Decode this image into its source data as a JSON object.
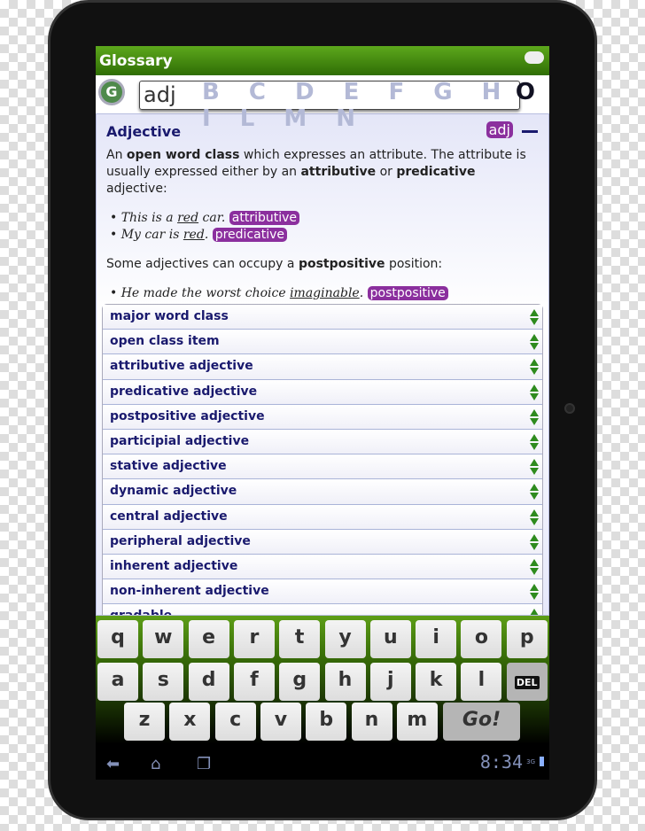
{
  "app": {
    "title": "Glossary"
  },
  "alphabet": {
    "letters": "B C D E F G H I L M N",
    "last": "O"
  },
  "search": {
    "value": "adj",
    "logo": "G"
  },
  "entry": {
    "title": "Adjective",
    "tag": "adj",
    "p1_a": "An ",
    "p1_b": "open word class",
    "p1_c": " which expresses an attribute. The attribute is usually expressed either by an ",
    "p1_d": "attributive",
    "p1_e": " or ",
    "p1_f": "predicative",
    "p1_g": " adjective:",
    "ex1_a": "This is a ",
    "ex1_b": "red",
    "ex1_c": " car.",
    "ex1_tag": "attributive",
    "ex2_a": "My car is ",
    "ex2_b": "red",
    "ex2_c": ".",
    "ex2_tag": "predicative",
    "p2_a": "Some adjectives can occupy a ",
    "p2_b": "postpositive",
    "p2_c": " position:",
    "ex3_a": "He made the worst choice ",
    "ex3_b": "imaginable",
    "ex3_c": ".",
    "ex3_tag": "postpositive"
  },
  "related": [
    "major word class",
    "open class item",
    "attributive adjective",
    "predicative adjective",
    "postpositive adjective",
    "participial adjective",
    "stative adjective",
    "dynamic adjective",
    "central adjective",
    "peripheral adjective",
    "inherent adjective",
    "non-inherent adjective",
    "gradable"
  ],
  "keyboard": {
    "row1": [
      "q",
      "w",
      "e",
      "r",
      "t",
      "y",
      "u",
      "i",
      "o",
      "p"
    ],
    "row2": [
      "a",
      "s",
      "d",
      "f",
      "g",
      "h",
      "j",
      "k",
      "l"
    ],
    "row3": [
      "z",
      "x",
      "c",
      "v",
      "b",
      "n",
      "m"
    ],
    "del": "DEL",
    "go": "Go!"
  },
  "status": {
    "time": "8:34",
    "network": "3G"
  },
  "colors": {
    "accent": "#4f9a14",
    "tag": "#8b2f9e",
    "text": "#1a1a6e"
  }
}
